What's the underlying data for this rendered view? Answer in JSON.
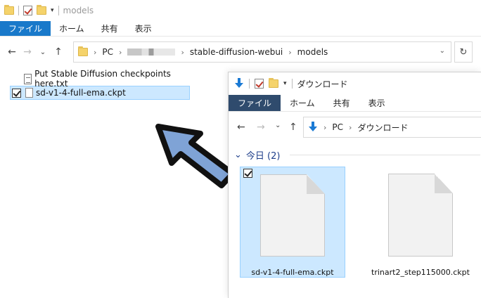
{
  "back_window": {
    "title": "models",
    "ribbon_tabs": [
      "ファイル",
      "ホーム",
      "共有",
      "表示"
    ],
    "breadcrumb": [
      "PC",
      "stable-diffusion-webui",
      "models"
    ],
    "files": [
      {
        "name": "Put Stable Diffusion checkpoints here.txt",
        "selected": false
      },
      {
        "name": "sd-v1-4-full-ema.ckpt",
        "selected": true
      }
    ]
  },
  "front_window": {
    "title": "ダウンロード",
    "ribbon_tabs": [
      "ファイル",
      "ホーム",
      "共有",
      "表示"
    ],
    "breadcrumb": [
      "PC",
      "ダウンロード"
    ],
    "group_header": "今日 (2)",
    "files": [
      {
        "name": "sd-v1-4-full-ema.ckpt",
        "selected": true
      },
      {
        "name": "trinart2_step115000.ckpt",
        "selected": false
      }
    ]
  },
  "colors": {
    "back_file_tab": "#1979ca",
    "front_file_tab": "#2f4b6d",
    "selection": "#cce8ff",
    "arrow_fill": "#7fa3d6"
  }
}
